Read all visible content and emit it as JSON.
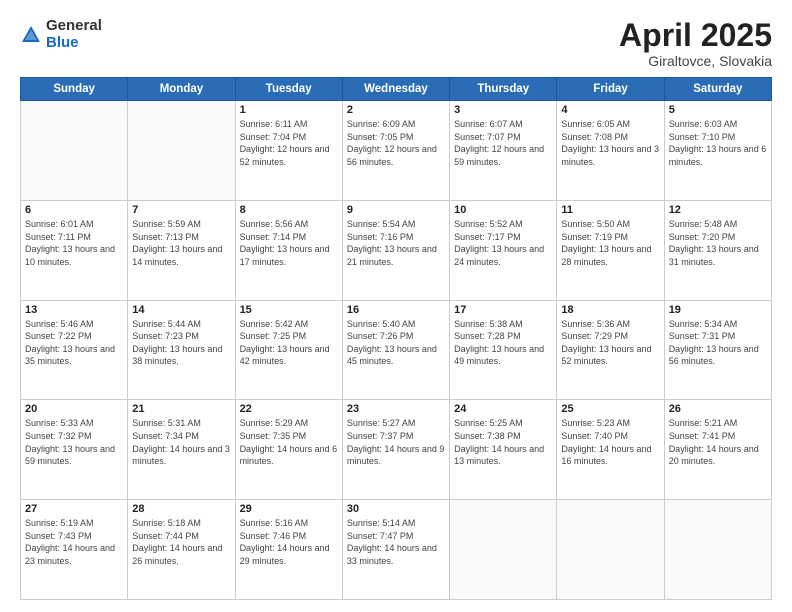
{
  "logo": {
    "general": "General",
    "blue": "Blue"
  },
  "title": {
    "month": "April 2025",
    "location": "Giraltovce, Slovakia"
  },
  "days": [
    "Sunday",
    "Monday",
    "Tuesday",
    "Wednesday",
    "Thursday",
    "Friday",
    "Saturday"
  ],
  "weeks": [
    [
      {
        "day": null,
        "info": null
      },
      {
        "day": null,
        "info": null
      },
      {
        "day": "1",
        "sunrise": "Sunrise: 6:11 AM",
        "sunset": "Sunset: 7:04 PM",
        "daylight": "Daylight: 12 hours and 52 minutes."
      },
      {
        "day": "2",
        "sunrise": "Sunrise: 6:09 AM",
        "sunset": "Sunset: 7:05 PM",
        "daylight": "Daylight: 12 hours and 56 minutes."
      },
      {
        "day": "3",
        "sunrise": "Sunrise: 6:07 AM",
        "sunset": "Sunset: 7:07 PM",
        "daylight": "Daylight: 12 hours and 59 minutes."
      },
      {
        "day": "4",
        "sunrise": "Sunrise: 6:05 AM",
        "sunset": "Sunset: 7:08 PM",
        "daylight": "Daylight: 13 hours and 3 minutes."
      },
      {
        "day": "5",
        "sunrise": "Sunrise: 6:03 AM",
        "sunset": "Sunset: 7:10 PM",
        "daylight": "Daylight: 13 hours and 6 minutes."
      }
    ],
    [
      {
        "day": "6",
        "sunrise": "Sunrise: 6:01 AM",
        "sunset": "Sunset: 7:11 PM",
        "daylight": "Daylight: 13 hours and 10 minutes."
      },
      {
        "day": "7",
        "sunrise": "Sunrise: 5:59 AM",
        "sunset": "Sunset: 7:13 PM",
        "daylight": "Daylight: 13 hours and 14 minutes."
      },
      {
        "day": "8",
        "sunrise": "Sunrise: 5:56 AM",
        "sunset": "Sunset: 7:14 PM",
        "daylight": "Daylight: 13 hours and 17 minutes."
      },
      {
        "day": "9",
        "sunrise": "Sunrise: 5:54 AM",
        "sunset": "Sunset: 7:16 PM",
        "daylight": "Daylight: 13 hours and 21 minutes."
      },
      {
        "day": "10",
        "sunrise": "Sunrise: 5:52 AM",
        "sunset": "Sunset: 7:17 PM",
        "daylight": "Daylight: 13 hours and 24 minutes."
      },
      {
        "day": "11",
        "sunrise": "Sunrise: 5:50 AM",
        "sunset": "Sunset: 7:19 PM",
        "daylight": "Daylight: 13 hours and 28 minutes."
      },
      {
        "day": "12",
        "sunrise": "Sunrise: 5:48 AM",
        "sunset": "Sunset: 7:20 PM",
        "daylight": "Daylight: 13 hours and 31 minutes."
      }
    ],
    [
      {
        "day": "13",
        "sunrise": "Sunrise: 5:46 AM",
        "sunset": "Sunset: 7:22 PM",
        "daylight": "Daylight: 13 hours and 35 minutes."
      },
      {
        "day": "14",
        "sunrise": "Sunrise: 5:44 AM",
        "sunset": "Sunset: 7:23 PM",
        "daylight": "Daylight: 13 hours and 38 minutes."
      },
      {
        "day": "15",
        "sunrise": "Sunrise: 5:42 AM",
        "sunset": "Sunset: 7:25 PM",
        "daylight": "Daylight: 13 hours and 42 minutes."
      },
      {
        "day": "16",
        "sunrise": "Sunrise: 5:40 AM",
        "sunset": "Sunset: 7:26 PM",
        "daylight": "Daylight: 13 hours and 45 minutes."
      },
      {
        "day": "17",
        "sunrise": "Sunrise: 5:38 AM",
        "sunset": "Sunset: 7:28 PM",
        "daylight": "Daylight: 13 hours and 49 minutes."
      },
      {
        "day": "18",
        "sunrise": "Sunrise: 5:36 AM",
        "sunset": "Sunset: 7:29 PM",
        "daylight": "Daylight: 13 hours and 52 minutes."
      },
      {
        "day": "19",
        "sunrise": "Sunrise: 5:34 AM",
        "sunset": "Sunset: 7:31 PM",
        "daylight": "Daylight: 13 hours and 56 minutes."
      }
    ],
    [
      {
        "day": "20",
        "sunrise": "Sunrise: 5:33 AM",
        "sunset": "Sunset: 7:32 PM",
        "daylight": "Daylight: 13 hours and 59 minutes."
      },
      {
        "day": "21",
        "sunrise": "Sunrise: 5:31 AM",
        "sunset": "Sunset: 7:34 PM",
        "daylight": "Daylight: 14 hours and 3 minutes."
      },
      {
        "day": "22",
        "sunrise": "Sunrise: 5:29 AM",
        "sunset": "Sunset: 7:35 PM",
        "daylight": "Daylight: 14 hours and 6 minutes."
      },
      {
        "day": "23",
        "sunrise": "Sunrise: 5:27 AM",
        "sunset": "Sunset: 7:37 PM",
        "daylight": "Daylight: 14 hours and 9 minutes."
      },
      {
        "day": "24",
        "sunrise": "Sunrise: 5:25 AM",
        "sunset": "Sunset: 7:38 PM",
        "daylight": "Daylight: 14 hours and 13 minutes."
      },
      {
        "day": "25",
        "sunrise": "Sunrise: 5:23 AM",
        "sunset": "Sunset: 7:40 PM",
        "daylight": "Daylight: 14 hours and 16 minutes."
      },
      {
        "day": "26",
        "sunrise": "Sunrise: 5:21 AM",
        "sunset": "Sunset: 7:41 PM",
        "daylight": "Daylight: 14 hours and 20 minutes."
      }
    ],
    [
      {
        "day": "27",
        "sunrise": "Sunrise: 5:19 AM",
        "sunset": "Sunset: 7:43 PM",
        "daylight": "Daylight: 14 hours and 23 minutes."
      },
      {
        "day": "28",
        "sunrise": "Sunrise: 5:18 AM",
        "sunset": "Sunset: 7:44 PM",
        "daylight": "Daylight: 14 hours and 26 minutes."
      },
      {
        "day": "29",
        "sunrise": "Sunrise: 5:16 AM",
        "sunset": "Sunset: 7:46 PM",
        "daylight": "Daylight: 14 hours and 29 minutes."
      },
      {
        "day": "30",
        "sunrise": "Sunrise: 5:14 AM",
        "sunset": "Sunset: 7:47 PM",
        "daylight": "Daylight: 14 hours and 33 minutes."
      },
      {
        "day": null,
        "info": null
      },
      {
        "day": null,
        "info": null
      },
      {
        "day": null,
        "info": null
      }
    ]
  ]
}
